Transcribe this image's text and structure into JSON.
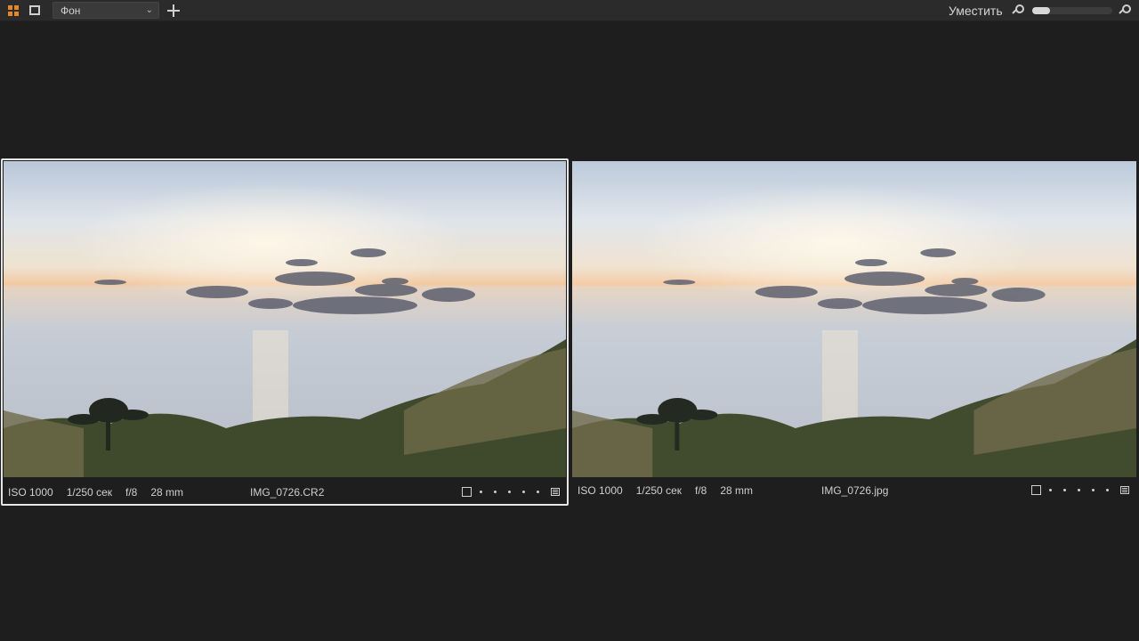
{
  "toolbar": {
    "layout_select_value": "Фон",
    "fit_label": "Уместить",
    "zoom_level": 0.22
  },
  "viewers": [
    {
      "iso": "ISO 1000",
      "shutter": "1/250 сек",
      "aperture": "f/8",
      "focal": "28 mm",
      "filename": "IMG_0726.CR2",
      "selected": true
    },
    {
      "iso": "ISO 1000",
      "shutter": "1/250 сек",
      "aperture": "f/8",
      "focal": "28 mm",
      "filename": "IMG_0726.jpg",
      "selected": false
    }
  ],
  "colors": {
    "accent": "#e8862a",
    "background": "#1e1e1e",
    "toolbar": "#2b2b2b"
  }
}
